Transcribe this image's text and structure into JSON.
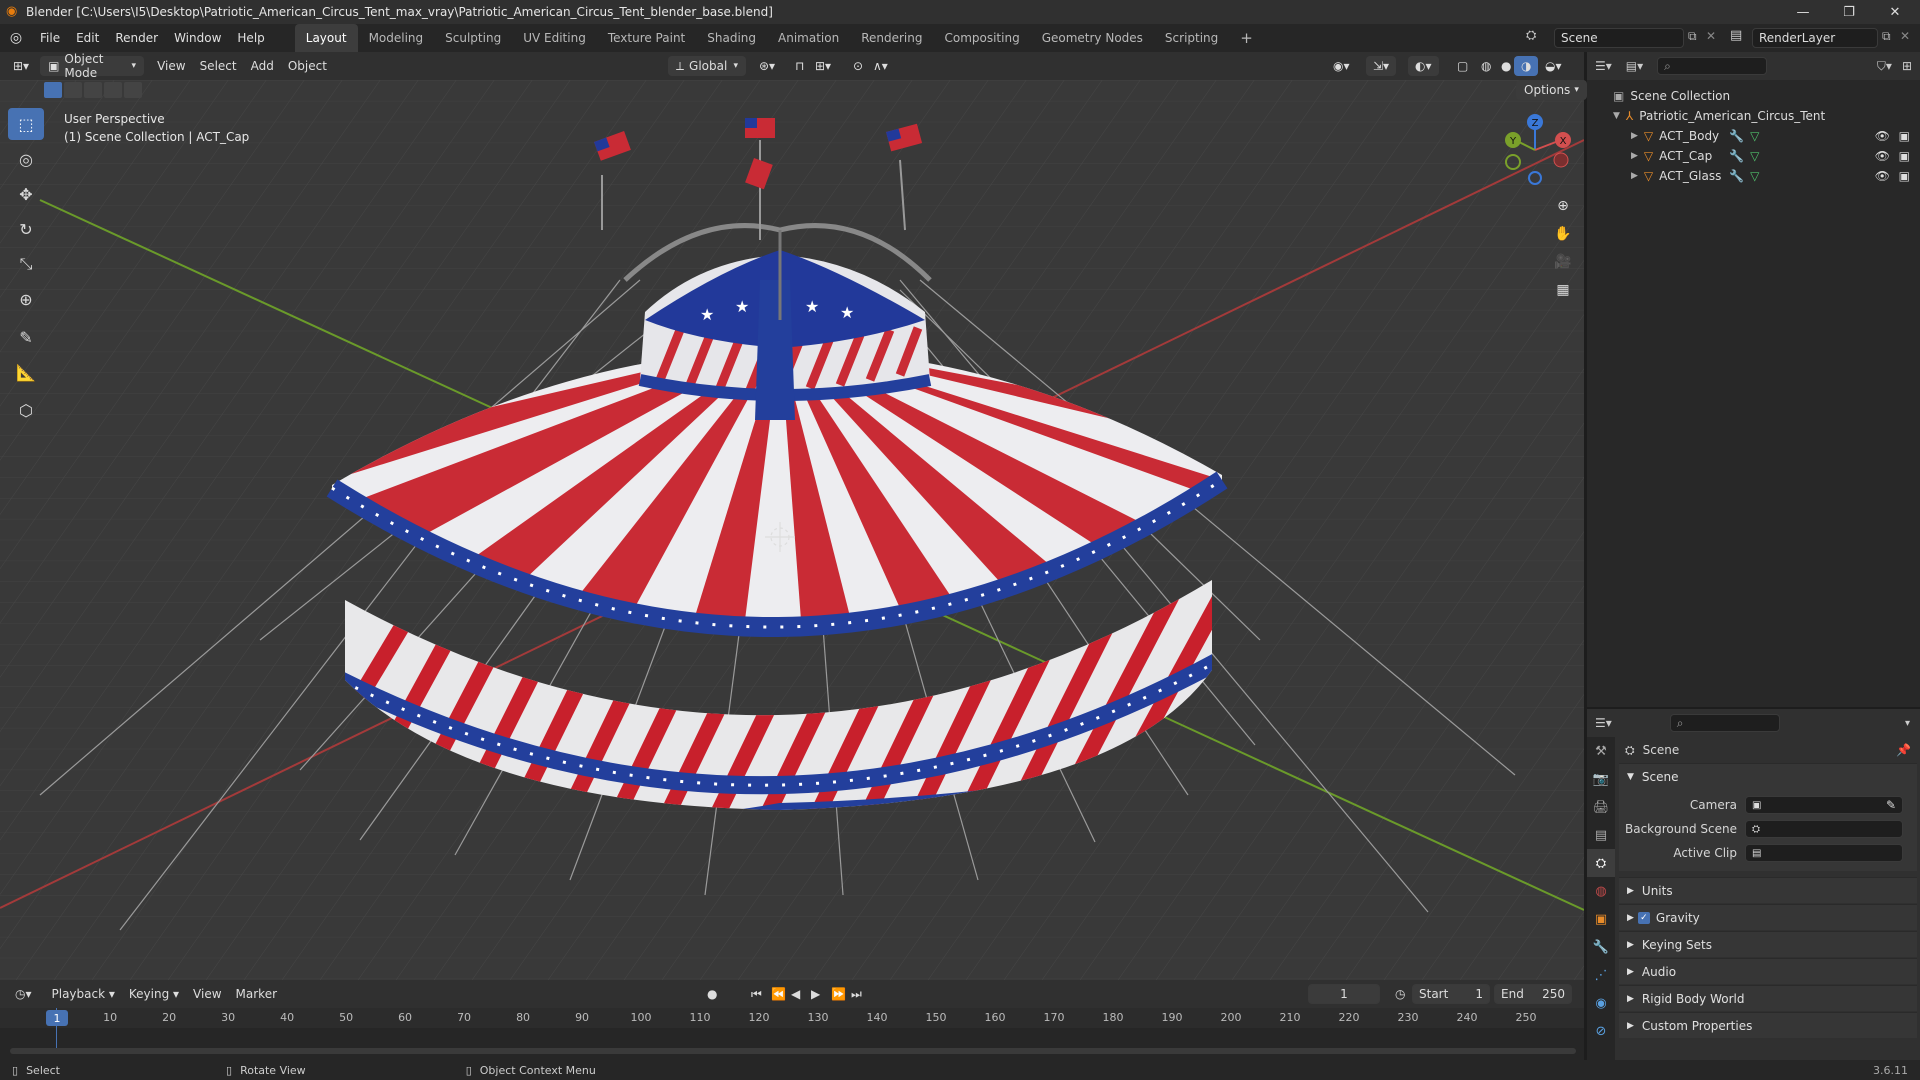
{
  "window": {
    "title": "Blender [C:\\Users\\I5\\Desktop\\Patriotic_American_Circus_Tent_max_vray\\Patriotic_American_Circus_Tent_blender_base.blend]",
    "minimize": "—",
    "maximize": "❐",
    "close": "✕"
  },
  "menu": [
    "File",
    "Edit",
    "Render",
    "Window",
    "Help"
  ],
  "workspaces": [
    "Layout",
    "Modeling",
    "Sculpting",
    "UV Editing",
    "Texture Paint",
    "Shading",
    "Animation",
    "Rendering",
    "Compositing",
    "Geometry Nodes",
    "Scripting"
  ],
  "scene_name": "Scene",
  "render_layer": "RenderLayer",
  "viewport_header": {
    "mode": "Object Mode",
    "menus": [
      "View",
      "Select",
      "Add",
      "Object"
    ],
    "orientation": "Global",
    "options": "Options"
  },
  "viewport_overlay": {
    "line1": "User Perspective",
    "line2": "(1) Scene Collection | ACT_Cap"
  },
  "gizmo": {
    "z": "Z",
    "y": "Y",
    "x": "X"
  },
  "outliner": {
    "root": "Scene Collection",
    "collection": "Patriotic_American_Circus_Tent",
    "objects": [
      "ACT_Body",
      "ACT_Cap",
      "ACT_Glass"
    ]
  },
  "properties": {
    "title": "Scene",
    "section": "Scene",
    "fields": [
      {
        "label": "Camera",
        "value": ""
      },
      {
        "label": "Background Scene",
        "value": ""
      },
      {
        "label": "Active Clip",
        "value": ""
      }
    ],
    "panels": [
      "Units",
      "Gravity",
      "Keying Sets",
      "Audio",
      "Rigid Body World",
      "Custom Properties"
    ],
    "gravity_checked": true
  },
  "timeline": {
    "menus": [
      "Playback",
      "Keying",
      "View",
      "Marker"
    ],
    "current_frame": "1",
    "start_label": "Start",
    "start": "1",
    "end_label": "End",
    "end": "250",
    "ticks": [
      "1",
      "10",
      "20",
      "30",
      "40",
      "50",
      "60",
      "70",
      "80",
      "90",
      "100",
      "110",
      "120",
      "130",
      "140",
      "150",
      "160",
      "170",
      "180",
      "190",
      "200",
      "210",
      "220",
      "230",
      "240",
      "250"
    ]
  },
  "statusbar": {
    "select": "Select",
    "rotate": "Rotate View",
    "context": "Object Context Menu",
    "version": "3.6.11"
  },
  "colors": {
    "accent": "#4772b3",
    "tent_red": "#c92b35",
    "tent_blue": "#233f9c",
    "axis_x": "#b33a3a",
    "axis_y": "#6a9a2a"
  }
}
